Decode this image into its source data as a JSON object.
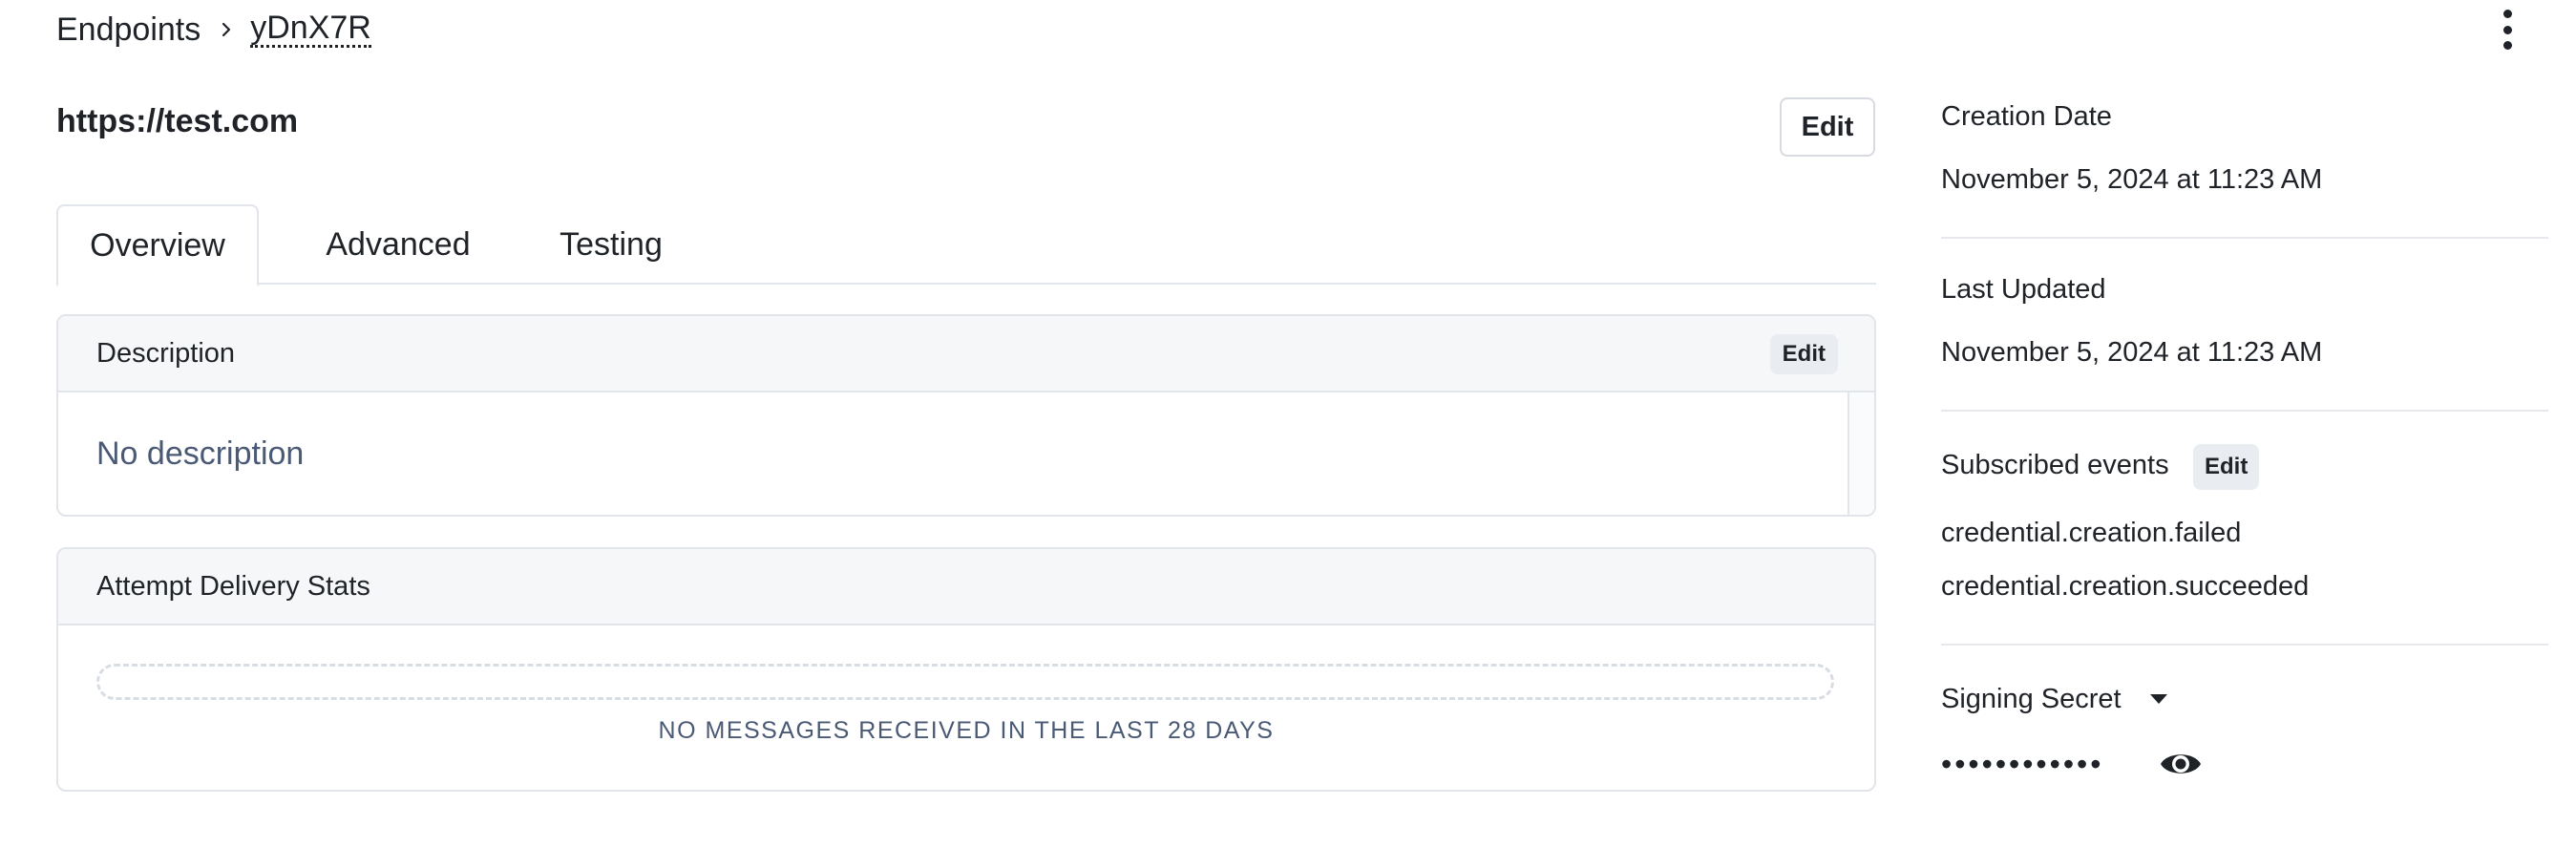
{
  "breadcrumb": {
    "root": "Endpoints",
    "current": "yDnX7R"
  },
  "header": {
    "url": "https://test.com",
    "edit_label": "Edit"
  },
  "tabs": [
    {
      "label": "Overview",
      "active": true
    },
    {
      "label": "Advanced",
      "active": false
    },
    {
      "label": "Testing",
      "active": false
    }
  ],
  "description": {
    "title": "Description",
    "edit_label": "Edit",
    "body": "No description"
  },
  "stats": {
    "title": "Attempt Delivery Stats",
    "empty_message": "NO MESSAGES RECEIVED IN THE LAST 28 DAYS"
  },
  "sidebar": {
    "creation_label": "Creation Date",
    "creation_value": "November 5, 2024 at 11:23 AM",
    "updated_label": "Last Updated",
    "updated_value": "November 5, 2024 at 11:23 AM",
    "events_label": "Subscribed events",
    "events_edit_label": "Edit",
    "events": [
      "credential.creation.failed",
      "credential.creation.succeeded"
    ],
    "secret_label": "Signing Secret",
    "secret_masked": "••••••••••••"
  },
  "icons": {
    "breadcrumb_separator": "chevron-right-icon",
    "menu": "more-vertical-icon",
    "secret_toggle": "caret-down-icon",
    "reveal": "eye-icon"
  }
}
